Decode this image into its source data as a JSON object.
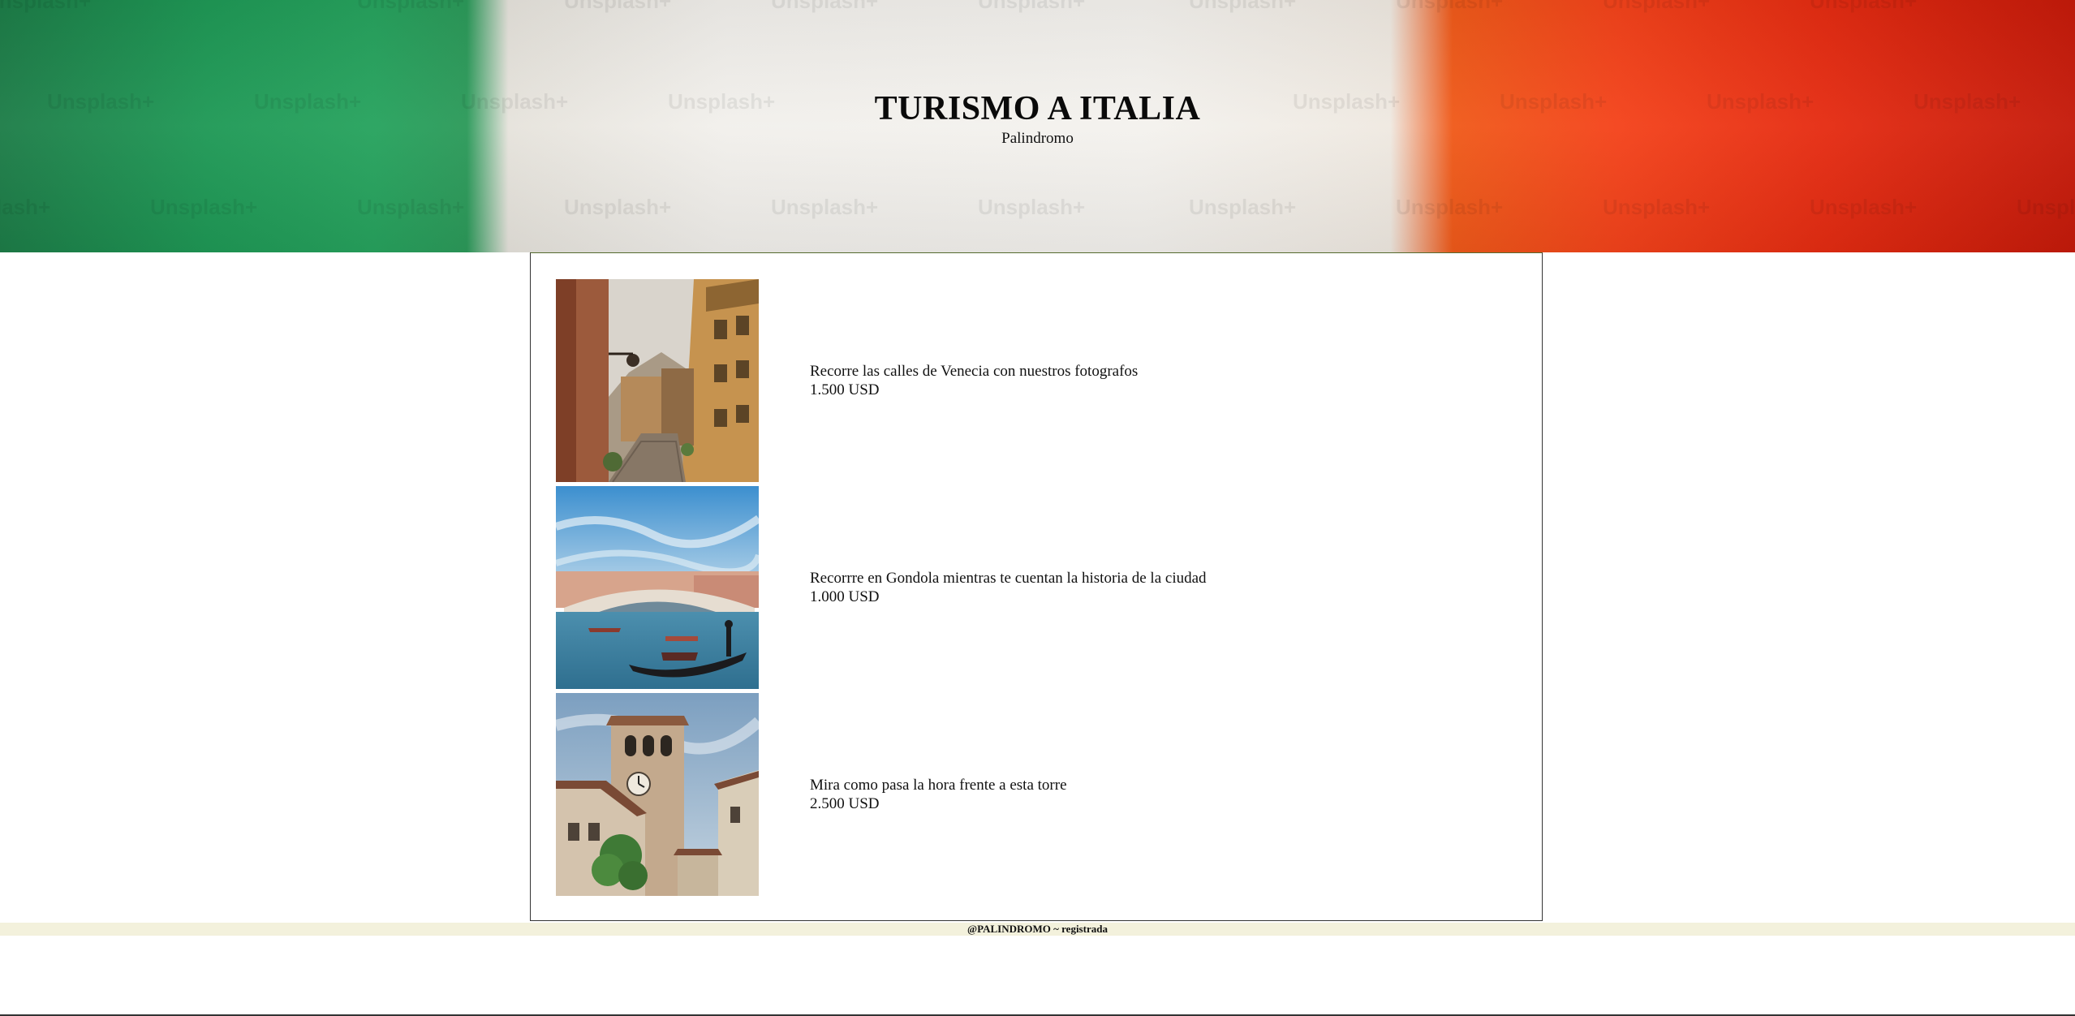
{
  "header": {
    "title": "TURISMO A ITALIA",
    "subtitle": "Palindromo",
    "watermark": "Unsplash+",
    "flag_colors": [
      "#27a35e",
      "#f2f0ec",
      "#e52c12"
    ]
  },
  "tours": [
    {
      "description": "Recorre las calles de Venecia con nuestros fotografos",
      "price": "1.500 USD",
      "image": "venice-street-photo"
    },
    {
      "description": "Recorrre en Gondola mientras te cuentan la historia de la ciudad",
      "price": "1.000 USD",
      "image": "gondola-rialto-photo"
    },
    {
      "description": "Mira como pasa la hora frente a esta torre",
      "price": "2.500 USD",
      "image": "clock-tower-photo"
    }
  ],
  "footer": {
    "text": "@PALINDROMO ~ registrada"
  }
}
